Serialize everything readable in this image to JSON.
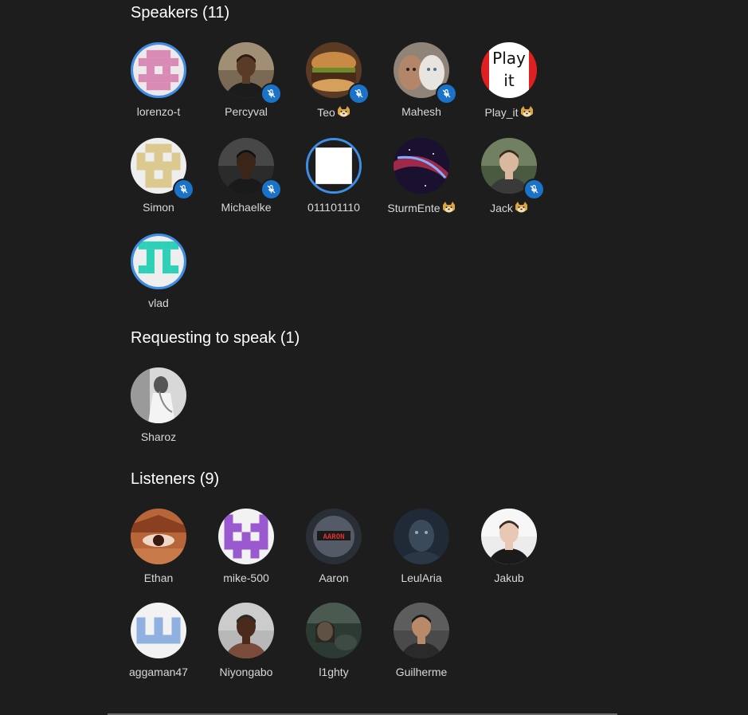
{
  "speakers": {
    "title": "Speakers (11)",
    "users": [
      {
        "name": "lorenzo-t",
        "muted": false,
        "speaking": true,
        "emoji": false
      },
      {
        "name": "Percyval",
        "muted": true,
        "speaking": false,
        "emoji": false
      },
      {
        "name": "Teo",
        "muted": true,
        "speaking": false,
        "emoji": true
      },
      {
        "name": "Mahesh",
        "muted": true,
        "speaking": false,
        "emoji": false
      },
      {
        "name": "Play_it",
        "muted": false,
        "speaking": false,
        "emoji": true,
        "avatar_text": "Play it"
      },
      {
        "name": "Simon",
        "muted": true,
        "speaking": false,
        "emoji": false
      },
      {
        "name": "Michaelke",
        "muted": true,
        "speaking": false,
        "emoji": false
      },
      {
        "name": "011101110",
        "muted": false,
        "speaking": true,
        "emoji": false
      },
      {
        "name": "SturmEnte",
        "muted": false,
        "speaking": false,
        "emoji": true
      },
      {
        "name": "Jack",
        "muted": true,
        "speaking": false,
        "emoji": true
      },
      {
        "name": "vlad",
        "muted": false,
        "speaking": true,
        "emoji": false
      }
    ]
  },
  "requesting": {
    "title": "Requesting to speak (1)",
    "users": [
      {
        "name": "Sharoz"
      }
    ]
  },
  "listeners": {
    "title": "Listeners (9)",
    "users": [
      {
        "name": "Ethan"
      },
      {
        "name": "mike-500"
      },
      {
        "name": "Aaron"
      },
      {
        "name": "LeulAria"
      },
      {
        "name": "Jakub"
      },
      {
        "name": "aggaman47"
      },
      {
        "name": "Niyongabo"
      },
      {
        "name": "l1ghty"
      },
      {
        "name": "Guilherme"
      }
    ]
  },
  "colors": {
    "background": "#1d1d1d",
    "speaking_ring": "#3d8ee6",
    "mute_badge": "#1a73c8"
  },
  "icons": {
    "mute": "mic-off-icon",
    "emoji": "doge-emoji-icon"
  }
}
